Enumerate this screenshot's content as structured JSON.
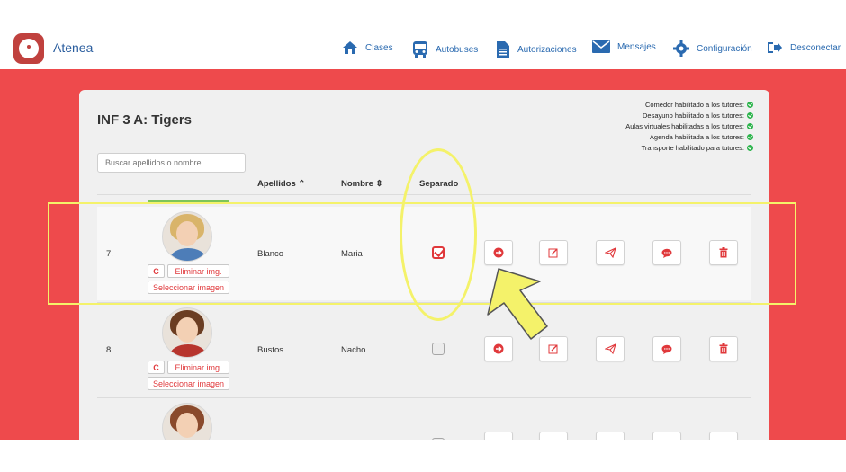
{
  "app": {
    "brand": "Atenea"
  },
  "nav": {
    "clases": "Clases",
    "autobuses": "Autobuses",
    "autorizaciones": "Autorizaciones",
    "mensajes": "Mensajes",
    "configuracion": "Configuración",
    "desconectar": "Desconectar"
  },
  "course": {
    "title": "INF 3 A: Tigers"
  },
  "enabled": [
    "Comedor habilitado a los tutores:",
    "Desayuno habilitado a los tutores:",
    "Aulas virtuales habilitadas a los tutores:",
    "Agenda habilitada a los tutores:",
    "Transporte habilitado para tutores:"
  ],
  "search": {
    "placeholder": "Buscar apellidos o nombre"
  },
  "table": {
    "col_apellidos": "Apellidos ⌃",
    "col_nombre": "Nombre ⇕",
    "col_separado": "Separado"
  },
  "row_buttons": {
    "refresh": "C",
    "eliminar": "Eliminar img.",
    "seleccionar": "Seleccionar imagen"
  },
  "rows": [
    {
      "num": "7.",
      "apellidos": "Blanco",
      "nombre": "Maria",
      "separado": true
    },
    {
      "num": "8.",
      "apellidos": "Bustos",
      "nombre": "Nacho",
      "separado": false
    },
    {
      "separado": false
    }
  ],
  "colors": {
    "accent": "#e0383b",
    "background_red": "#ee4a4c",
    "nav_blue": "#2a6ab0",
    "highlight": "#f4f26a"
  },
  "icons": [
    "home-icon",
    "bus-icon",
    "document-icon",
    "envelope-icon",
    "gear-icon",
    "logout-icon",
    "arrow-circle-icon",
    "edit-icon",
    "send-icon",
    "chat-icon",
    "trash-icon"
  ]
}
